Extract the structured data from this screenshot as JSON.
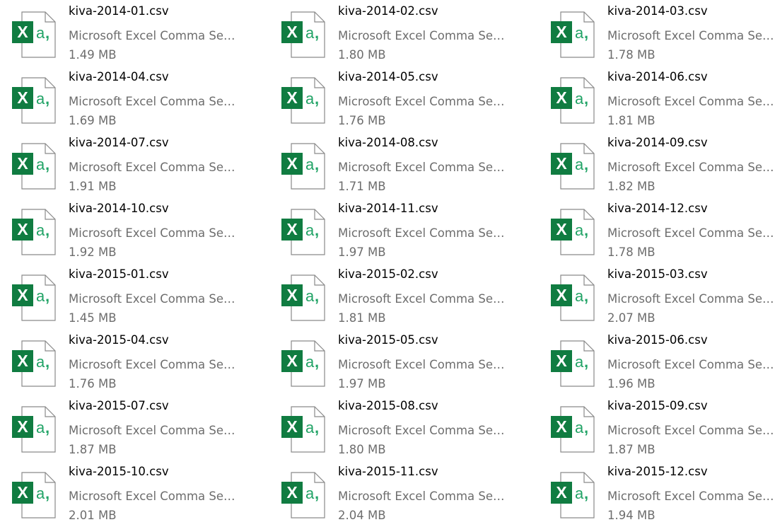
{
  "files": [
    {
      "name": "kiva-2014-01.csv",
      "type": "Microsoft Excel Comma Separated Values File",
      "size": "1.49 MB",
      "icon": "excel-csv-file-icon"
    },
    {
      "name": "kiva-2014-02.csv",
      "type": "Microsoft Excel Comma Separated Values File",
      "size": "1.80 MB",
      "icon": "excel-csv-file-icon"
    },
    {
      "name": "kiva-2014-03.csv",
      "type": "Microsoft Excel Comma Separated Values File",
      "size": "1.78 MB",
      "icon": "excel-csv-file-icon"
    },
    {
      "name": "kiva-2014-04.csv",
      "type": "Microsoft Excel Comma Separated Values File",
      "size": "1.69 MB",
      "icon": "excel-csv-file-icon"
    },
    {
      "name": "kiva-2014-05.csv",
      "type": "Microsoft Excel Comma Separated Values File",
      "size": "1.76 MB",
      "icon": "excel-csv-file-icon"
    },
    {
      "name": "kiva-2014-06.csv",
      "type": "Microsoft Excel Comma Separated Values File",
      "size": "1.81 MB",
      "icon": "excel-csv-file-icon"
    },
    {
      "name": "kiva-2014-07.csv",
      "type": "Microsoft Excel Comma Separated Values File",
      "size": "1.91 MB",
      "icon": "excel-csv-file-icon"
    },
    {
      "name": "kiva-2014-08.csv",
      "type": "Microsoft Excel Comma Separated Values File",
      "size": "1.71 MB",
      "icon": "excel-csv-file-icon"
    },
    {
      "name": "kiva-2014-09.csv",
      "type": "Microsoft Excel Comma Separated Values File",
      "size": "1.82 MB",
      "icon": "excel-csv-file-icon"
    },
    {
      "name": "kiva-2014-10.csv",
      "type": "Microsoft Excel Comma Separated Values File",
      "size": "1.92 MB",
      "icon": "excel-csv-file-icon"
    },
    {
      "name": "kiva-2014-11.csv",
      "type": "Microsoft Excel Comma Separated Values File",
      "size": "1.97 MB",
      "icon": "excel-csv-file-icon"
    },
    {
      "name": "kiva-2014-12.csv",
      "type": "Microsoft Excel Comma Separated Values File",
      "size": "1.78 MB",
      "icon": "excel-csv-file-icon"
    },
    {
      "name": "kiva-2015-01.csv",
      "type": "Microsoft Excel Comma Separated Values File",
      "size": "1.45 MB",
      "icon": "excel-csv-file-icon"
    },
    {
      "name": "kiva-2015-02.csv",
      "type": "Microsoft Excel Comma Separated Values File",
      "size": "1.81 MB",
      "icon": "excel-csv-file-icon"
    },
    {
      "name": "kiva-2015-03.csv",
      "type": "Microsoft Excel Comma Separated Values File",
      "size": "2.07 MB",
      "icon": "excel-csv-file-icon"
    },
    {
      "name": "kiva-2015-04.csv",
      "type": "Microsoft Excel Comma Separated Values File",
      "size": "1.76 MB",
      "icon": "excel-csv-file-icon"
    },
    {
      "name": "kiva-2015-05.csv",
      "type": "Microsoft Excel Comma Separated Values File",
      "size": "1.97 MB",
      "icon": "excel-csv-file-icon"
    },
    {
      "name": "kiva-2015-06.csv",
      "type": "Microsoft Excel Comma Separated Values File",
      "size": "1.96 MB",
      "icon": "excel-csv-file-icon"
    },
    {
      "name": "kiva-2015-07.csv",
      "type": "Microsoft Excel Comma Separated Values File",
      "size": "1.87 MB",
      "icon": "excel-csv-file-icon"
    },
    {
      "name": "kiva-2015-08.csv",
      "type": "Microsoft Excel Comma Separated Values File",
      "size": "1.80 MB",
      "icon": "excel-csv-file-icon"
    },
    {
      "name": "kiva-2015-09.csv",
      "type": "Microsoft Excel Comma Separated Values File",
      "size": "1.87 MB",
      "icon": "excel-csv-file-icon"
    },
    {
      "name": "kiva-2015-10.csv",
      "type": "Microsoft Excel Comma Separated Values File",
      "size": "2.01 MB",
      "icon": "excel-csv-file-icon"
    },
    {
      "name": "kiva-2015-11.csv",
      "type": "Microsoft Excel Comma Separated Values File",
      "size": "2.04 MB",
      "icon": "excel-csv-file-icon"
    },
    {
      "name": "kiva-2015-12.csv",
      "type": "Microsoft Excel Comma Separated Values File",
      "size": "1.94 MB",
      "icon": "excel-csv-file-icon"
    }
  ],
  "colors": {
    "excel_green": "#107c41",
    "csv_teal": "#21a366",
    "page_outline": "#8a8a8a",
    "secondary_text": "#6d6d6d"
  }
}
